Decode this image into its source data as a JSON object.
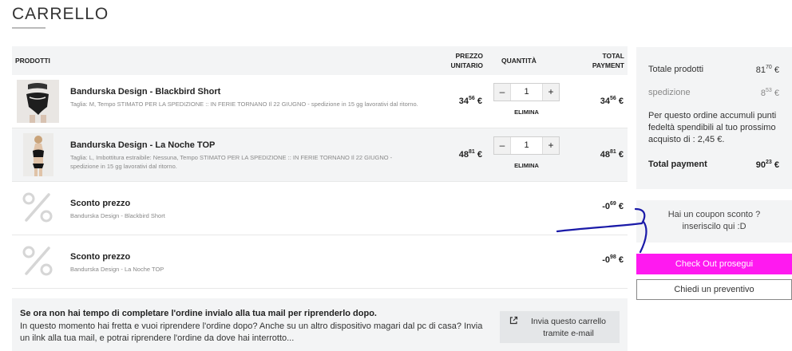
{
  "page": {
    "title": "CARRELLO"
  },
  "table": {
    "headers": {
      "products": "PRODOTTI",
      "unit_price": "PREZZO UNITARIO",
      "quantity": "QUANTITÀ",
      "total": "TOTAL PAYMENT"
    },
    "rows": [
      {
        "name": "Bandurska Design - Blackbird Short",
        "desc": "Taglia: M, Tempo STIMATO PER LA SPEDIZIONE :: IN FERIE TORNANO Il 22 GIUGNO - spedizione in 15 gg lavorativi dal ritorno.",
        "price_int": "34",
        "price_dec": "56",
        "quantity": "1",
        "total_int": "34",
        "total_dec": "56",
        "currency": "€",
        "remove_label": "ELIMINA",
        "minus": "–",
        "plus": "+"
      },
      {
        "name": "Bandurska Design - La Noche TOP",
        "desc": "Taglia: L, Imbottitura estraibile: Nessuna, Tempo STIMATO PER LA SPEDIZIONE :: IN FERIE TORNANO Il 22 GIUGNO - spedizione in 15 gg lavorativi dal ritorno.",
        "price_int": "48",
        "price_dec": "81",
        "quantity": "1",
        "total_int": "48",
        "total_dec": "81",
        "currency": "€",
        "remove_label": "ELIMINA",
        "minus": "–",
        "plus": "+"
      },
      {
        "name": "Sconto prezzo",
        "desc": "Bandurska Design - Blackbird Short",
        "total_int": "-0",
        "total_dec": "69",
        "currency": "€"
      },
      {
        "name": "Sconto prezzo",
        "desc": "Bandurska Design - La Noche TOP",
        "total_int": "-0",
        "total_dec": "98",
        "currency": "€"
      }
    ]
  },
  "promo": {
    "title": "Se ora non hai tempo di completare l'ordine invialo alla tua mail per riprenderlo dopo.",
    "text": "In questo momento hai fretta e vuoi riprendere l'ordine dopo? Anche su un altro dispositivo magari dal pc di casa? Invia un ilnk alla tua mail, e potrai riprendere l'ordine da dove hai interrotto...",
    "button": "Invia questo carrello tramite e-mail"
  },
  "summary": {
    "products_label": "Totale prodotti",
    "products_int": "81",
    "products_dec": "70",
    "shipping_label": "spedizione",
    "shipping_int": "8",
    "shipping_dec": "53",
    "note": "Per questo ordine accumuli punti fedeltà spendibili al tuo prossimo acquisto di : 2,45 €.",
    "total_label": "Total payment",
    "total_int": "90",
    "total_dec": "23",
    "currency": "€"
  },
  "coupon": {
    "text": "Hai un coupon sconto ? inseriscilo qui :D"
  },
  "actions": {
    "checkout": "Check Out prosegui",
    "quote": "Chiedi un preventivo"
  },
  "colors": {
    "accent": "#ff19f0",
    "panel": "#f3f4f5",
    "annotation": "#1a1aa8"
  },
  "icons": [
    "percent-icon",
    "share-icon"
  ]
}
